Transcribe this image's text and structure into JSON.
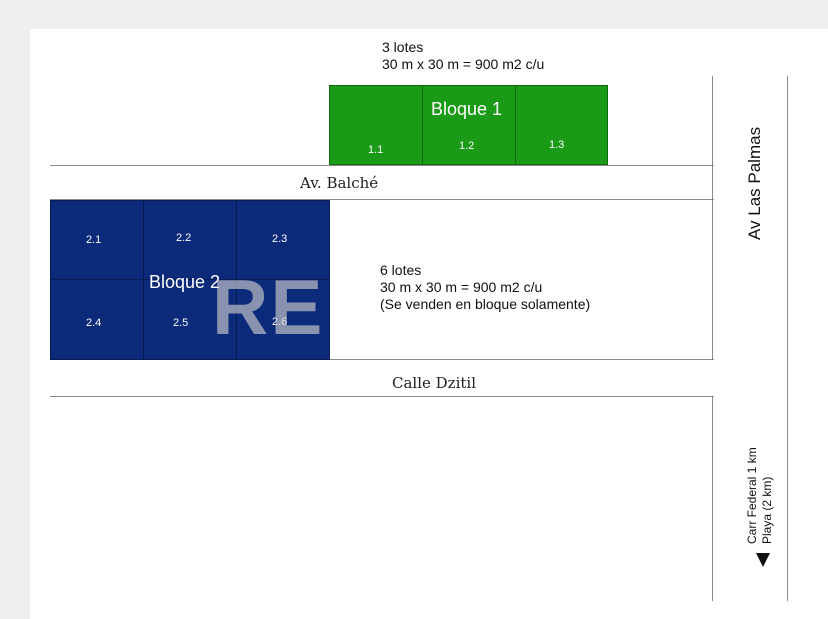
{
  "bloque1": {
    "count_line": "3 lotes",
    "dims_line": "30 m x 30 m = 900 m2 c/u",
    "label": "Bloque 1",
    "lots": [
      "1.1",
      "1.2",
      "1.3"
    ],
    "color": "#1a9a16"
  },
  "bloque2": {
    "count_line": "6 lotes",
    "dims_line": "30 m x 30 m = 900 m2 c/u",
    "note_line": "(Se venden en bloque solamente)",
    "label": "Bloque 2",
    "lots": [
      "2.1",
      "2.2",
      "2.3",
      "2.4",
      "2.5",
      "2.6"
    ],
    "color": "#0c2a7a"
  },
  "streets": {
    "balche": "Av. Balché",
    "dzitil": "Calle Dzitil",
    "las_palmas": "Av Las Palmas"
  },
  "directions": {
    "line1": "Carr Federal 1 km",
    "line2": "Playa (2 km)"
  },
  "watermark": "RE"
}
